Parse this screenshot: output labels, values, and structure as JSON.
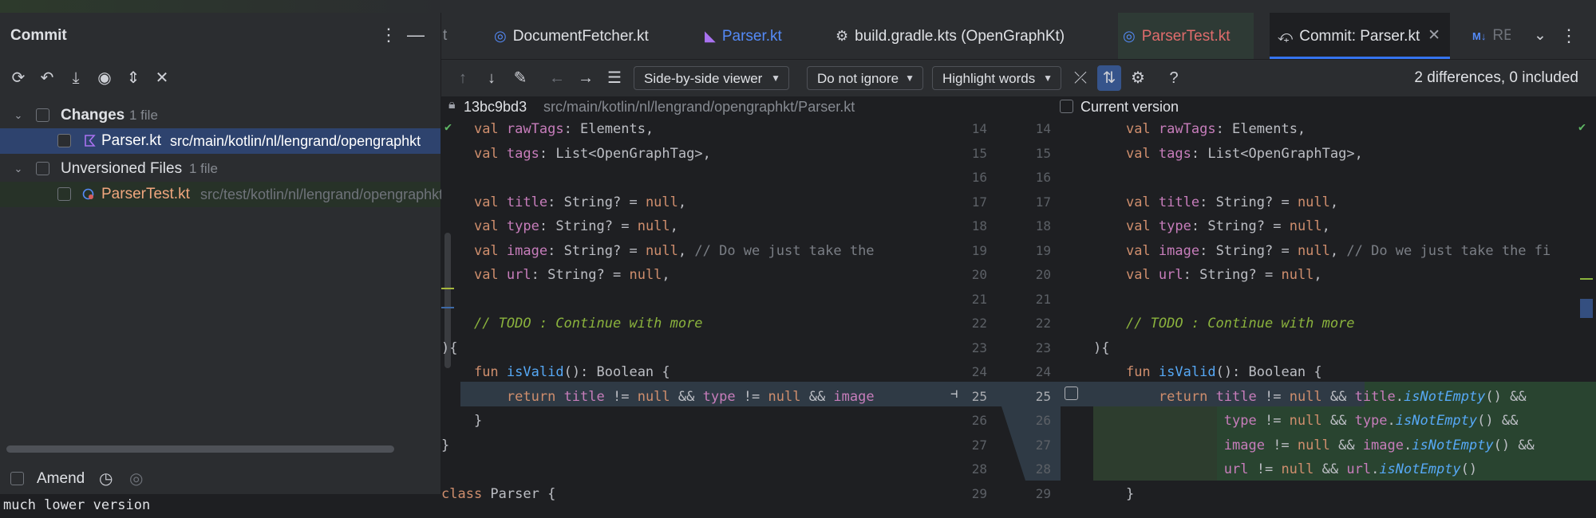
{
  "commit_panel": {
    "title": "Commit",
    "menu_icon": "more-vertical-icon",
    "minimize_icon": "minimize-icon",
    "toolbar_icons": [
      "refresh-icon",
      "rollback-icon",
      "shelve-icon",
      "preview-diff-icon",
      "expand-all-icon",
      "collapse-all-icon"
    ],
    "tree": {
      "changes": {
        "label": "Changes",
        "count": "1 file"
      },
      "changes_file": {
        "name": "Parser.kt",
        "path": "src/main/kotlin/nl/lengrand/opengraphkt"
      },
      "unversioned": {
        "label": "Unversioned Files",
        "count": "1 file"
      },
      "unversioned_file": {
        "name": "ParserTest.kt",
        "path": "src/test/kotlin/nl/lengrand/opengraphkt"
      }
    },
    "amend_label": "Amend",
    "commit_message": "much lower version"
  },
  "tabs": [
    {
      "label": "t",
      "icon": ""
    },
    {
      "label": "DocumentFetcher.kt",
      "icon": "kotlin-class-icon"
    },
    {
      "label": "Parser.kt",
      "icon": "kotlin-file-icon"
    },
    {
      "label": "build.gradle.kts (OpenGraphKt)",
      "icon": "gradle-icon"
    },
    {
      "label": "ParserTest.kt",
      "icon": "kotlin-test-icon"
    },
    {
      "label": "Commit: Parser.kt",
      "icon": "commit-icon"
    },
    {
      "label": "RE",
      "icon": "markdown-icon"
    }
  ],
  "diff_toolbar": {
    "viewer": "Side-by-side viewer",
    "whitespace": "Do not ignore",
    "highlight": "Highlight words",
    "summary": "2 differences, 0 included"
  },
  "path_bar": {
    "hash": "13bc9bd3",
    "path": "src/main/kotlin/nl/lengrand/opengraphkt/Parser.kt",
    "current_version": "Current version"
  },
  "diff": {
    "left_numbers": [
      "14",
      "15",
      "16",
      "17",
      "18",
      "19",
      "20",
      "21",
      "22",
      "23",
      "24",
      "25",
      "26",
      "27",
      "28",
      "29"
    ],
    "right_numbers": [
      "14",
      "15",
      "16",
      "17",
      "18",
      "19",
      "20",
      "21",
      "22",
      "23",
      "24",
      "25",
      "26",
      "27",
      "28",
      "29"
    ],
    "comment_left": "// Do we just take the",
    "comment_right": "// Do we just take the fi",
    "todo": "// TODO : Continue with more"
  },
  "colors": {
    "accent": "#3574f0",
    "changed": "#2f3a45",
    "inserted": "#294430",
    "kotlin_purple": "#a972f0"
  }
}
